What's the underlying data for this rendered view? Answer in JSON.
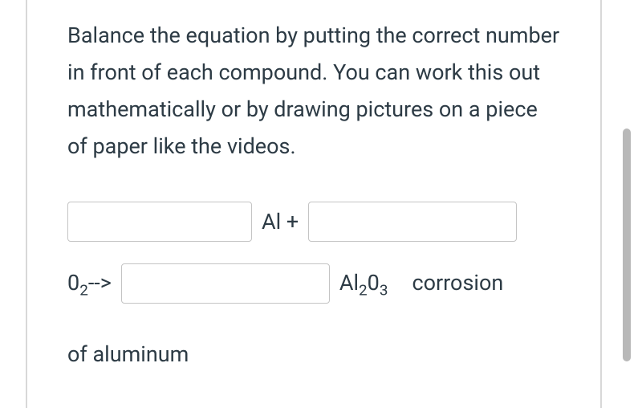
{
  "instructions": "Balance the equation by putting the correct number in front of each compound. You can work this out mathematically or by drawing pictures on a piece of paper like the videos.",
  "equation": {
    "input1_value": "",
    "al_plus": "Al +",
    "input2_value": "",
    "o2_arrow_prefix": "0",
    "o2_arrow_sub": "2",
    "o2_arrow_suffix": "-->",
    "input3_value": "",
    "al2o3_prefix": "Al",
    "al2o3_sub1": "2",
    "al2o3_mid": "0",
    "al2o3_sub2": "3",
    "corrosion": "corrosion",
    "of_aluminum": "of aluminum"
  }
}
